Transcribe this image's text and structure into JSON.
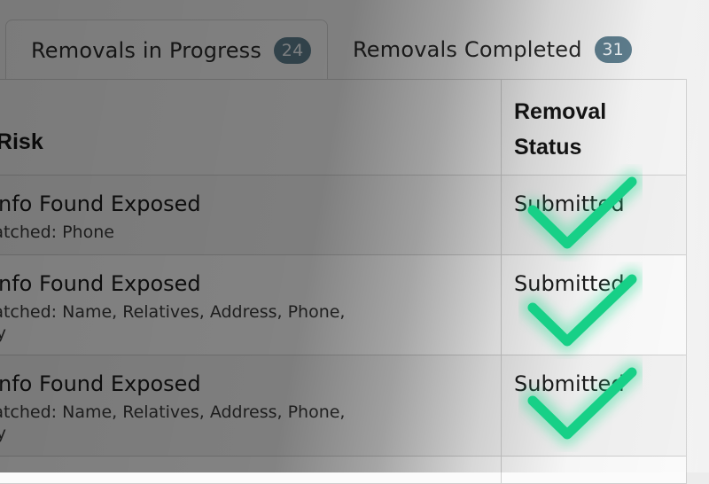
{
  "tabs": [
    {
      "label": "Removals in Progress",
      "count": "24",
      "active": true
    },
    {
      "label": "Removals Completed",
      "count": "31",
      "active": false
    }
  ],
  "table": {
    "headers": {
      "exposure": "osure / Risk",
      "status_line1": "Removal",
      "status_line2": "Status"
    },
    "rows": [
      {
        "title": "onal Info Found Exposed",
        "matched_line1": "s Matched: Phone",
        "matched_line2": "",
        "status": "Submitted"
      },
      {
        "title": "onal Info Found Exposed",
        "matched_line1": "s Matched: Name, Relatives, Address, Phone,",
        "matched_line2": "pany",
        "status": "Submitted"
      },
      {
        "title": "onal Info Found Exposed",
        "matched_line1": "s Matched: Name, Relatives, Address, Phone,",
        "matched_line2": "pany",
        "status": "Submitted"
      }
    ]
  },
  "colors": {
    "check": "#17d087",
    "badge": "#5f7f8f"
  },
  "icons": {
    "status_check": "checkmark-icon"
  }
}
